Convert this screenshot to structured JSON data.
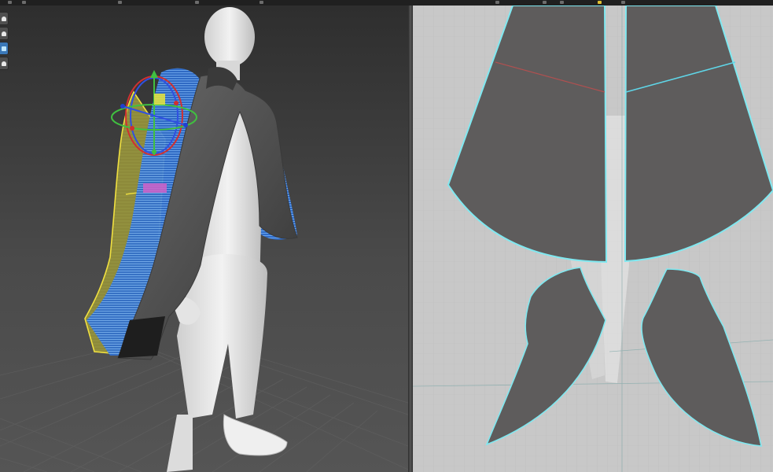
{
  "app": {
    "colors": {
      "viewport_3d_bg": "#4a4a4a",
      "floor_grid": "#5a5a5a",
      "avatar": "#e6e6e6",
      "cape_fabric": "#555555",
      "fabric_outline_3d": "#f0e040",
      "fabric_mesh_3d": "#3d8fe0",
      "pattern_panel": "#5e5c5c",
      "pattern_outline": "#7fe8f0",
      "pattern_internal_line": "#5fd6e8",
      "pattern_seam_red": "#b05050",
      "canvas_2d_bg": "#c8c8c8",
      "active_tool": "#e0c030"
    },
    "top_toolbar": {
      "icons": [
        "select-pattern-icon",
        "transform-pattern-icon",
        "edit-point-icon",
        "polygon-icon",
        "rectangle-icon",
        "internal-line-icon",
        "segment-sewing-icon",
        "free-sewing-icon",
        "simulate-icon",
        "fold-arrangement-icon"
      ]
    },
    "viewport_3d": {
      "label_hidden": true,
      "view_toolbar": {
        "buttons": [
          {
            "icon": "avatar-full-icon",
            "selected": false
          },
          {
            "icon": "avatar-front-icon",
            "selected": false
          },
          {
            "icon": "garment-view-icon",
            "selected": true
          },
          {
            "icon": "avatar-head-icon",
            "selected": false
          }
        ]
      },
      "gizmo": {
        "type": "rotation-translation"
      }
    },
    "viewport_2d": {
      "pattern_pieces": [
        "cape-back-left",
        "cape-back-right",
        "hood-left",
        "hood-right"
      ]
    }
  }
}
